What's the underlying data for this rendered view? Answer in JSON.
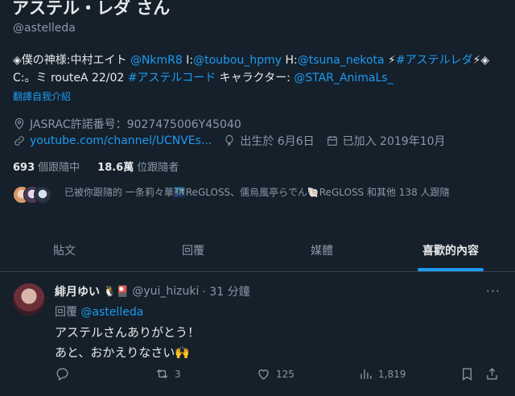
{
  "profile": {
    "display_name": "アステル・レダ さん",
    "handle": "@astelleda",
    "bio": {
      "p1": "◈僕の神様:中村エイト ",
      "m1": "@NkmR8",
      "p2": " I:",
      "m2": "@toubou_hpmy",
      "p3": " H:",
      "m3": "@tsuna_nekota",
      "p4": " ⚡",
      "h1": "#アステルレダ",
      "p5": "⚡◈ C:。ミ routeA 22/02 ",
      "h2": "#アステルコード",
      "p6": " キャラクター: ",
      "m4": "@STAR_AnimaLs_"
    },
    "translate_label": "翻譯自我介紹",
    "location": "JASRAC許諾番号：9027475006Y45040",
    "website": "youtube.com/channel/UCNVEs...",
    "birthday": "出生於 6月6日",
    "joined": "已加入 2019年10月",
    "following_count": "693",
    "following_label": "個跟隨中",
    "followers_count": "18.6萬",
    "followers_label": "位跟隨者",
    "followed_by": "已被你跟隨的 一条莉々華🌃ReGLOSS、儒烏風亭らでん🐚ReGLOSS 和其他 138 人跟隨"
  },
  "tabs": [
    {
      "label": "貼文"
    },
    {
      "label": "回覆"
    },
    {
      "label": "媒體"
    },
    {
      "label": "喜歡的內容"
    }
  ],
  "tweet": {
    "author_name": "緋月ゆい",
    "author_emoji": "🐧🎴",
    "author_handle": "@yui_hizuki",
    "time": "· 31 分鐘",
    "reply_prefix": "回覆 ",
    "reply_to": "@astelleda",
    "text_line1": "アステルさんありがとう！",
    "text_line2": "あと、おかえりなさい🙌",
    "retweets": "3",
    "likes": "125",
    "views": "1,819"
  },
  "colors": {
    "background": "#15202b",
    "accent": "#1d9bf0",
    "text_primary": "#e7e9ea",
    "text_secondary": "#8b98a5"
  }
}
